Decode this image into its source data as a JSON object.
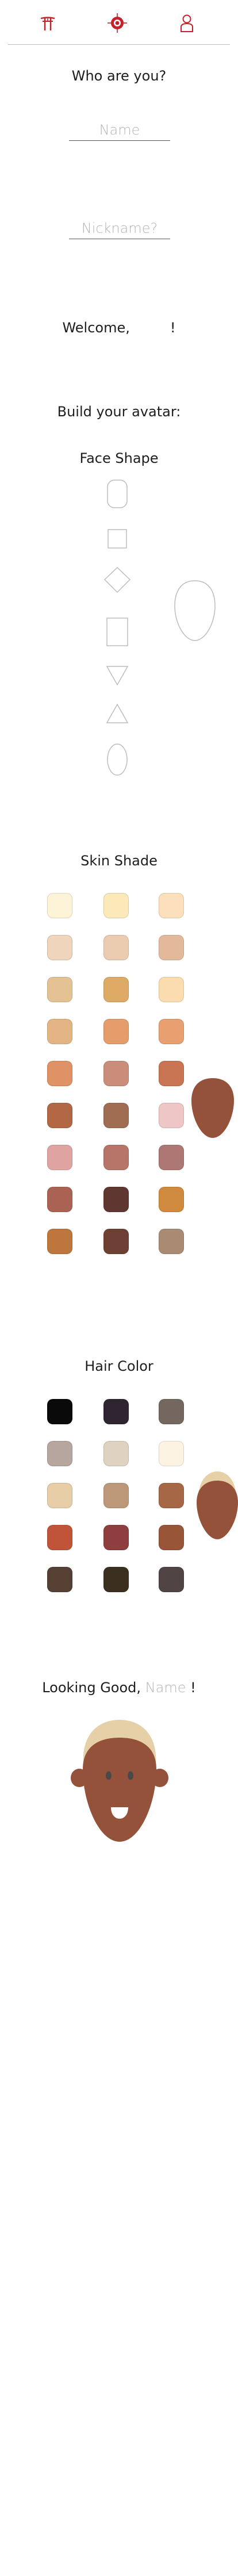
{
  "header": {
    "left_icon": "torii-gate-icon",
    "center_icon": "compass-target-icon",
    "right_icon": "person-outline-icon",
    "accent_color": "#c8202a"
  },
  "intro": {
    "question": "Who are you?",
    "name_placeholder": "Name",
    "nickname_placeholder": "Nickname?",
    "welcome_prefix": "Welcome,",
    "welcome_suffix": "!"
  },
  "avatar_builder": {
    "title": "Build your avatar:",
    "face_shape": {
      "label": "Face Shape",
      "options": [
        "rounded-rectangle",
        "square",
        "diamond",
        "rectangle",
        "inverted-triangle",
        "triangle",
        "oval"
      ],
      "preview_shape": "egg"
    },
    "skin_shade": {
      "label": "Skin Shade",
      "colors": [
        "#fdf3d6",
        "#fbe9b9",
        "#fbe0bb",
        "#eed5bb",
        "#ecccb1",
        "#e3b99b",
        "#e5c294",
        "#ddab66",
        "#fbdcaf",
        "#e4b584",
        "#e59d6b",
        "#e8a070",
        "#df9265",
        "#c98d79",
        "#c97452",
        "#b26844",
        "#a06d52",
        "#eec6c5",
        "#dfa4a2",
        "#b7756a",
        "#ad7774",
        "#aa6353",
        "#603730",
        "#d08a3e",
        "#bd773c",
        "#6e4034",
        "#a98b73"
      ],
      "preview_color": "#95523b"
    },
    "hair_color": {
      "label": "Hair Color",
      "colors": [
        "#0b0a0a",
        "#2e2530",
        "#736760",
        "#b7a69d",
        "#ded3c0",
        "#fdf3e2",
        "#e8cea6",
        "#bd9878",
        "#a56745",
        "#c05438",
        "#8e3e3c",
        "#985538",
        "#564034",
        "#3b3020",
        "#504444"
      ],
      "preview_color": "#e6d0a8"
    }
  },
  "result": {
    "prefix": "Looking Good,",
    "name_value": "Name",
    "suffix": "!",
    "face_color": "#95523b",
    "hair_color": "#e6d0a8",
    "eye_color": "#4a4a4a",
    "mouth_color": "#ffffff"
  }
}
